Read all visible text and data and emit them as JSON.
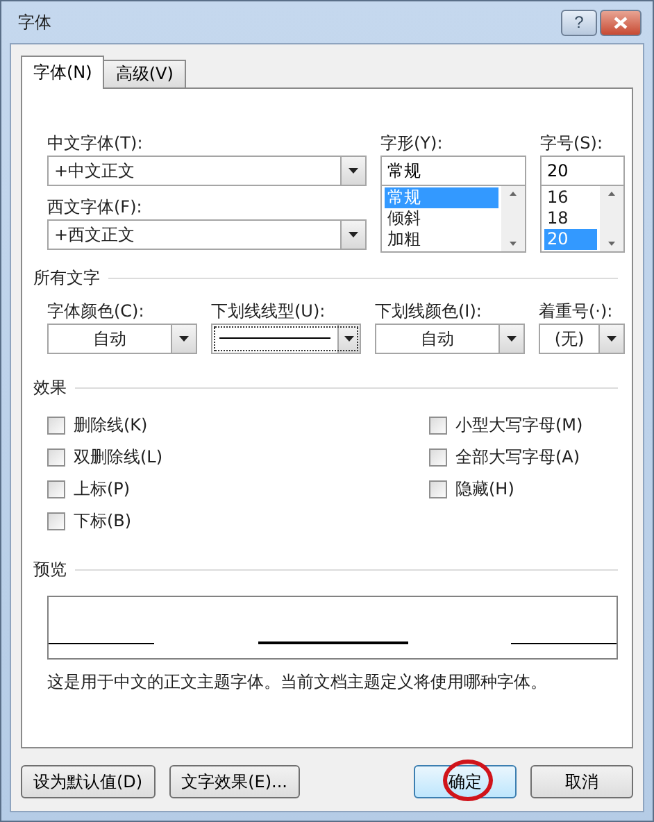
{
  "window": {
    "title": "字体",
    "help": "?"
  },
  "tabs": [
    {
      "label": "字体(N)",
      "selected": true
    },
    {
      "label": "高级(V)",
      "selected": false
    }
  ],
  "font": {
    "chinese": {
      "label": "中文字体(T):",
      "value": "+中文正文"
    },
    "western": {
      "label": "西文字体(F):",
      "value": "+西文正文"
    },
    "style": {
      "label": "字形(Y):",
      "value": "常规",
      "options": [
        {
          "label": "常规",
          "selected": true
        },
        {
          "label": "倾斜",
          "selected": false
        },
        {
          "label": "加粗",
          "selected": false
        }
      ]
    },
    "size": {
      "label": "字号(S):",
      "value": "20",
      "options": [
        {
          "label": "16",
          "selected": false
        },
        {
          "label": "18",
          "selected": false
        },
        {
          "label": "20",
          "selected": true
        }
      ]
    }
  },
  "all_text": {
    "heading": "所有文字",
    "fields": [
      {
        "label": "字体颜色(C):",
        "kind": "text",
        "value": "自动",
        "focused": false
      },
      {
        "label": "下划线线型(U):",
        "kind": "line",
        "focused": true
      },
      {
        "label": "下划线颜色(I):",
        "kind": "text",
        "value": "自动",
        "focused": false
      },
      {
        "label": "着重号(·):",
        "kind": "text",
        "value": "(无)",
        "focused": false
      }
    ]
  },
  "effects": {
    "heading": "效果",
    "left": [
      {
        "label": "删除线(K)",
        "checked": false
      },
      {
        "label": "双删除线(L)",
        "checked": false
      },
      {
        "label": "上标(P)",
        "checked": false
      },
      {
        "label": "下标(B)",
        "checked": false
      }
    ],
    "right": [
      {
        "label": "小型大写字母(M)",
        "checked": false
      },
      {
        "label": "全部大写字母(A)",
        "checked": false
      },
      {
        "label": "隐藏(H)",
        "checked": false
      }
    ]
  },
  "preview": {
    "heading": "预览",
    "description": "这是用于中文的正文主题字体。当前文档主题定义将使用哪种字体。"
  },
  "footer": {
    "left": [
      {
        "label": "设为默认值(D)",
        "default": false,
        "circled": false
      },
      {
        "label": "文字效果(E)...",
        "default": false,
        "circled": false
      }
    ],
    "right": [
      {
        "label": "确定",
        "default": true,
        "circled": true
      },
      {
        "label": "取消",
        "default": false,
        "circled": false
      }
    ]
  }
}
